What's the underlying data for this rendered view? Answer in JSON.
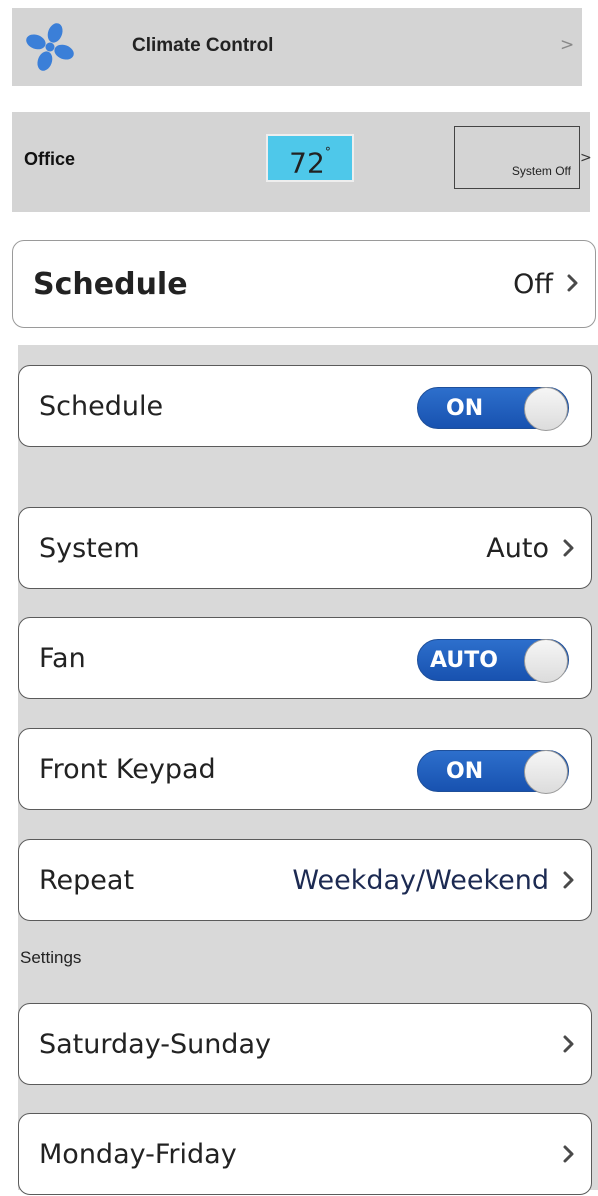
{
  "header": {
    "title": "Climate Control",
    "chevron": ">"
  },
  "room": {
    "name": "Office",
    "temperature": "72",
    "degree": "°",
    "system_label": "System Off",
    "chevron": ">"
  },
  "schedule_summary": {
    "label": "Schedule",
    "value": "Off"
  },
  "schedule_toggle": {
    "label": "Schedule",
    "state": "ON"
  },
  "system": {
    "label": "System",
    "value": "Auto"
  },
  "fan": {
    "label": "Fan",
    "state": "AUTO"
  },
  "front_keypad": {
    "label": "Front Keypad",
    "state": "ON"
  },
  "repeat": {
    "label": "Repeat",
    "value": "Weekday/Weekend"
  },
  "settings": {
    "heading": "Settings",
    "items": [
      {
        "label": "Saturday-Sunday"
      },
      {
        "label": "Monday-Friday"
      }
    ]
  },
  "colors": {
    "toggle_blue": "#1e5fc4",
    "temp_box": "#4ec8ea",
    "panel_gray": "#d9d9d9"
  }
}
